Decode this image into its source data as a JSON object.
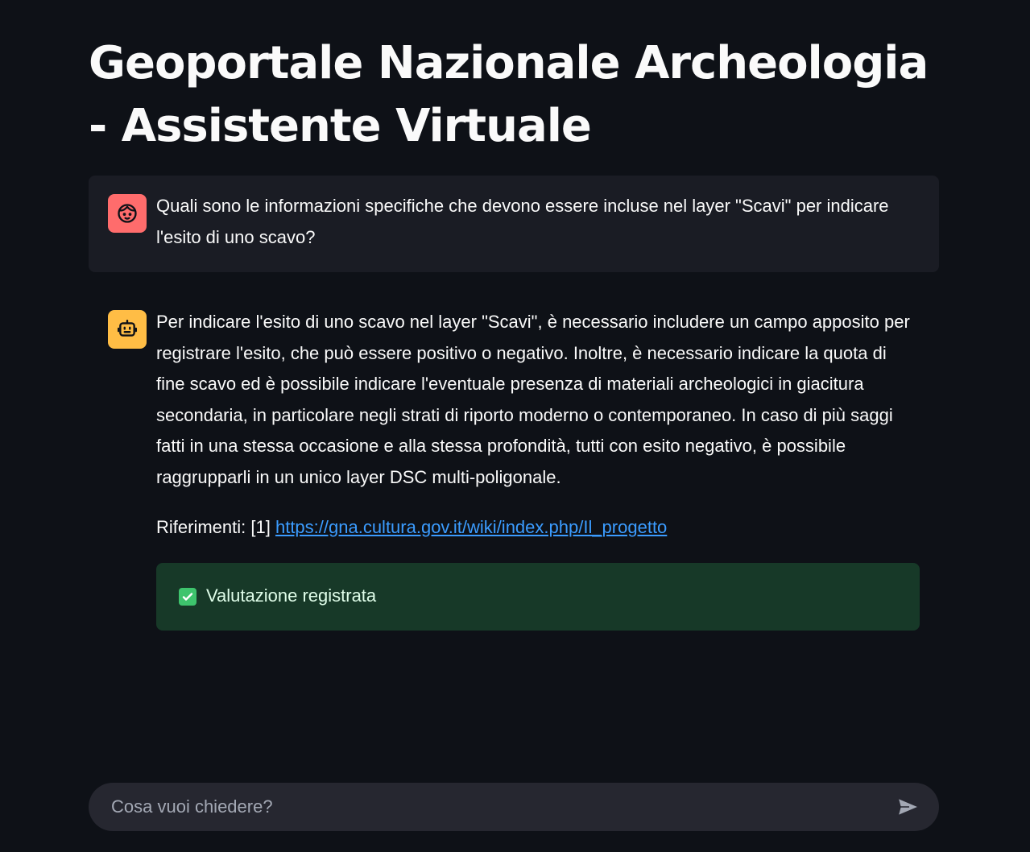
{
  "header": {
    "title": "Geoportale Nazionale Archeologia - Assistente Virtuale"
  },
  "messages": [
    {
      "role": "user",
      "avatar_icon": "user-face-icon",
      "text": "Quali sono le informazioni specifiche che devono essere incluse nel layer \"Scavi\" per indicare l'esito di uno scavo?"
    },
    {
      "role": "assistant",
      "avatar_icon": "robot-icon",
      "text": "Per indicare l'esito di uno scavo nel layer \"Scavi\", è necessario includere un campo apposito per registrare l'esito, che può essere positivo o negativo. Inoltre, è necessario indicare la quota di fine scavo ed è possibile indicare l'eventuale presenza di materiali archeologici in giacitura secondaria, in particolare negli strati di riporto moderno o contemporaneo. In caso di più saggi fatti in una stessa occasione e alla stessa profondità, tutti con esito negativo, è possibile raggrupparli in un unico layer DSC multi-poligonale.",
      "references_label": "Riferimenti:",
      "reference_index": "[1]",
      "reference_url": "https://gna.cultura.gov.it/wiki/index.php/Il_progetto"
    }
  ],
  "feedback": {
    "icon": "check-mark-icon",
    "text": "Valutazione registrata"
  },
  "chat_input": {
    "placeholder": "Cosa vuoi chiedere?",
    "value": "",
    "send_icon": "send-icon"
  },
  "colors": {
    "background": "#0e1117",
    "user_message_bg": "#1a1c24",
    "user_avatar": "#ff6c6c",
    "bot_avatar": "#ffbd45",
    "link": "#3b9cff",
    "success_bg": "#173928",
    "input_bg": "#262730"
  }
}
